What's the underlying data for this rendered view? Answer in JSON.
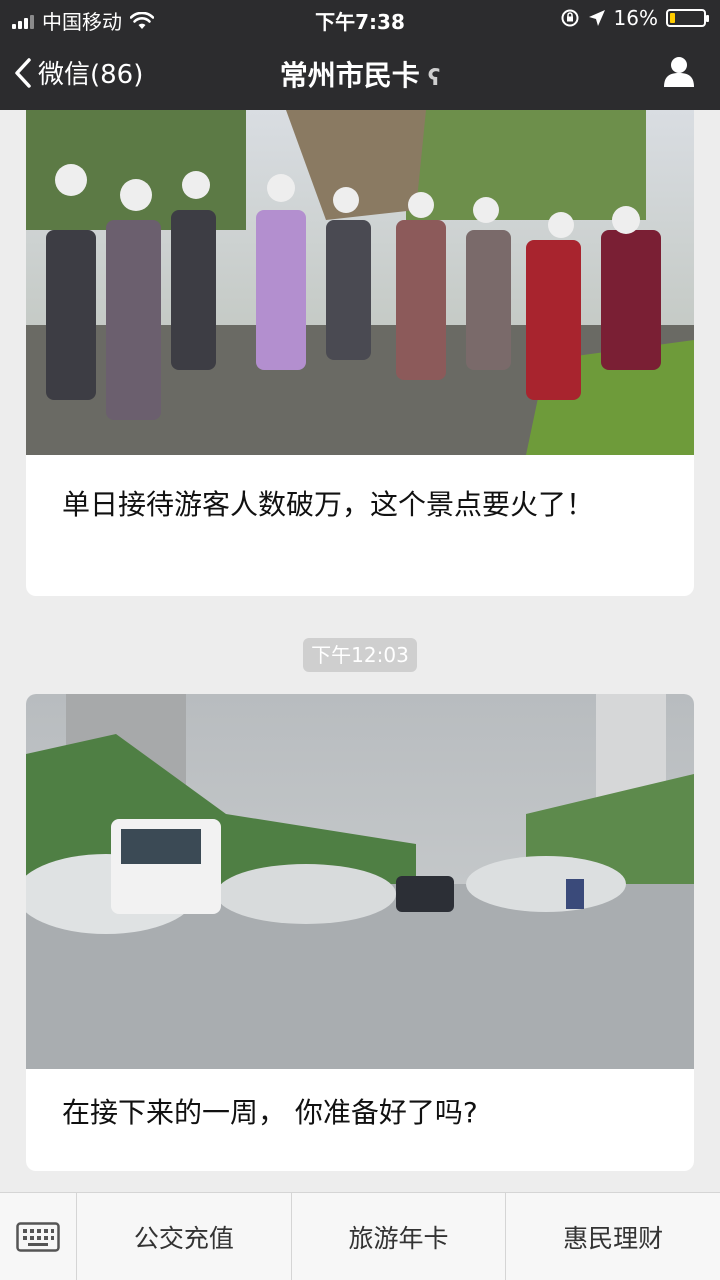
{
  "status_bar": {
    "carrier": "中国移动",
    "time": "下午7:38",
    "battery_percent": "16%",
    "battery_level": 0.16,
    "icons": [
      "signal-icon",
      "wifi-icon",
      "orientation-lock-icon",
      "location-icon",
      "battery-icon"
    ]
  },
  "nav": {
    "back_label": "微信(86)",
    "title": "常州市民卡",
    "icons": [
      "back-chevron-icon",
      "ear-icon",
      "profile-icon"
    ]
  },
  "messages": [
    {
      "caption": "单日接待游客人数破万，这个景点要火了！",
      "image": "crowd-of-tourists-photo"
    },
    {
      "timestamp": "下午12:03",
      "caption": "在接下来的一周， 你准备好了吗?",
      "image": "flooded-road-photo"
    }
  ],
  "menu": {
    "items": [
      "公交充值",
      "旅游年卡",
      "惠民理财"
    ],
    "keyboard_icon": "keyboard-icon"
  }
}
